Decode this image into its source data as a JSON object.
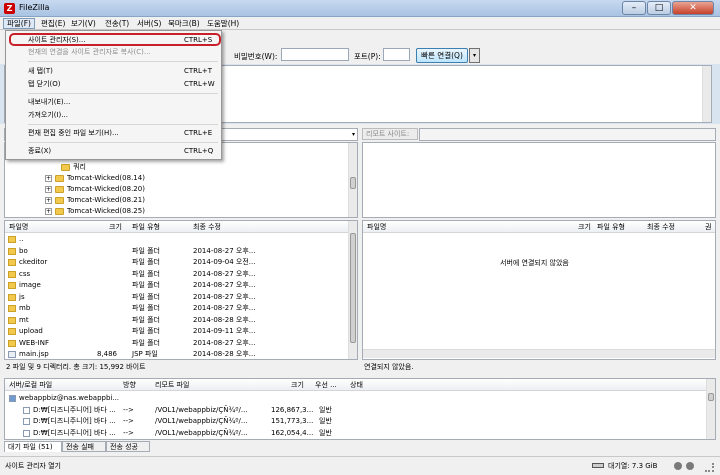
{
  "window": {
    "title": "FileZilla",
    "app_icon": "Z",
    "minimize": "–",
    "maximize": "□",
    "close": "✕"
  },
  "menubar": {
    "items": [
      "파일(F)",
      "편집(E)",
      "보기(V)",
      "전송(T)",
      "서버(S)",
      "북마크(B)",
      "도움말(H)"
    ]
  },
  "quickconnect": {
    "password_label": "비밀번호(W):",
    "port_label": "포트(P):",
    "connect_button": "빠른 연결(Q)",
    "dropdown": "▾"
  },
  "file_menu": {
    "items": [
      {
        "label": "사이트 관리자(S)...",
        "shortcut": "CTRL+S",
        "disabled": false
      },
      {
        "label": "현재의 연결을 사이트 관리자로 복사(C)...",
        "shortcut": "",
        "disabled": true
      },
      {
        "label": "새 탭(T)",
        "shortcut": "CTRL+T",
        "disabled": false
      },
      {
        "label": "탭 닫기(O)",
        "shortcut": "CTRL+W",
        "disabled": false
      },
      {
        "label": "내보내기(E)...",
        "shortcut": "",
        "disabled": false
      },
      {
        "label": "가져오기(I)...",
        "shortcut": "",
        "disabled": false
      },
      {
        "label": "편재 편집 중인 파일 보기(H)...",
        "shortcut": "CTRL+E",
        "disabled": false
      },
      {
        "label": "종료(X)",
        "shortcut": "CTRL+Q",
        "disabled": false
      }
    ]
  },
  "remote_site": {
    "label": "리모트 사이트:"
  },
  "local_tree": {
    "nodes": [
      "쿼리",
      "Tomcat-Wicked(08.14)",
      "Tomcat-Wicked(08.20)",
      "Tomcat-Wicked(08.21)",
      "Tomcat-Wicked(08.25)"
    ],
    "expander": "+"
  },
  "local_files": {
    "headers": [
      "파일명",
      "크기",
      "파일 유형",
      "최종 수정"
    ],
    "rows": [
      {
        "name": "..",
        "size": "",
        "type": "",
        "modified": ""
      },
      {
        "name": "bo",
        "size": "",
        "type": "파일 폴더",
        "modified": "2014-08-27 오후..."
      },
      {
        "name": "ckeditor",
        "size": "",
        "type": "파일 폴더",
        "modified": "2014-09-04 오전..."
      },
      {
        "name": "css",
        "size": "",
        "type": "파일 폴더",
        "modified": "2014-08-27 오후..."
      },
      {
        "name": "image",
        "size": "",
        "type": "파일 폴더",
        "modified": "2014-08-27 오후..."
      },
      {
        "name": "js",
        "size": "",
        "type": "파일 폴더",
        "modified": "2014-08-27 오후..."
      },
      {
        "name": "mb",
        "size": "",
        "type": "파일 폴더",
        "modified": "2014-08-27 오후..."
      },
      {
        "name": "mt",
        "size": "",
        "type": "파일 폴더",
        "modified": "2014-08-28 오후..."
      },
      {
        "name": "upload",
        "size": "",
        "type": "파일 폴더",
        "modified": "2014-09-11 오후..."
      },
      {
        "name": "WEB-INF",
        "size": "",
        "type": "파일 폴더",
        "modified": "2014-08-27 오후..."
      },
      {
        "name": "main.jsp",
        "size": "8,486",
        "type": "JSP 파일",
        "modified": "2014-08-28 오후..."
      }
    ],
    "status": "2 파일 및 9 디렉터리. 총 크기: 15,992 바이트"
  },
  "remote_files": {
    "headers": [
      "파일명",
      "크기",
      "파일 유형",
      "최종 수정",
      "권"
    ],
    "empty_message": "서버에 연결되지 않았음",
    "status": "연결되지 않았음."
  },
  "queue": {
    "headers": [
      "서버/로컬 파일",
      "방향",
      "리모트 파일",
      "크기",
      "우선 ...",
      "상태"
    ],
    "rows": [
      {
        "local": "webappbiz@nas.webappbi...",
        "dir": "",
        "remote": "",
        "size": "",
        "prio": ""
      },
      {
        "local": "D:₩[디즈니주니어] 바다 ...",
        "dir": "-->",
        "remote": "/VOL1/webappbiz/ÇÑ¾º/...",
        "size": "126,867,3...",
        "prio": "일반"
      },
      {
        "local": "D:₩[디즈니주니어] 바다 ...",
        "dir": "-->",
        "remote": "/VOL1/webappbiz/ÇÑ¾º/...",
        "size": "151,773,3...",
        "prio": "일반"
      },
      {
        "local": "D:₩[디즈니주니어] 바다 ...",
        "dir": "-->",
        "remote": "/VOL1/webappbiz/ÇÑ¾º/...",
        "size": "162,054,4...",
        "prio": "일반"
      }
    ],
    "tabs": [
      "대기 파일 (51)",
      "전송 실패",
      "전송 성공"
    ]
  },
  "statusbar": {
    "left": "사이트 관리자 열기",
    "queue": "대기열: 7.3 GiB"
  },
  "colors": {
    "highlight_border": "#c8202b",
    "title_bar": "#b5cce8",
    "menu_background": "#f5f5f5"
  }
}
